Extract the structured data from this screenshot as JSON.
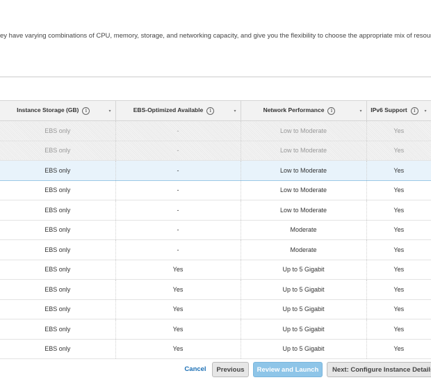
{
  "intro_text": "ey have varying combinations of CPU, memory, storage, and networking capacity, and give you the flexibility to choose the appropriate mix of resources",
  "columns": [
    {
      "label": "Instance Storage (GB)"
    },
    {
      "label": "EBS-Optimized Available"
    },
    {
      "label": "Network Performance"
    },
    {
      "label": "IPv6 Support"
    }
  ],
  "info_glyph": "i",
  "sort_glyph": "▾",
  "rows": [
    {
      "storage": "EBS only",
      "ebs": "-",
      "network": "Low to Moderate",
      "ipv6": "Yes",
      "state": "disabled"
    },
    {
      "storage": "EBS only",
      "ebs": "-",
      "network": "Low to Moderate",
      "ipv6": "Yes",
      "state": "disabled"
    },
    {
      "storage": "EBS only",
      "ebs": "-",
      "network": "Low to Moderate",
      "ipv6": "Yes",
      "state": "selected"
    },
    {
      "storage": "EBS only",
      "ebs": "-",
      "network": "Low to Moderate",
      "ipv6": "Yes",
      "state": "normal"
    },
    {
      "storage": "EBS only",
      "ebs": "-",
      "network": "Low to Moderate",
      "ipv6": "Yes",
      "state": "normal"
    },
    {
      "storage": "EBS only",
      "ebs": "-",
      "network": "Moderate",
      "ipv6": "Yes",
      "state": "normal"
    },
    {
      "storage": "EBS only",
      "ebs": "-",
      "network": "Moderate",
      "ipv6": "Yes",
      "state": "normal"
    },
    {
      "storage": "EBS only",
      "ebs": "Yes",
      "network": "Up to 5 Gigabit",
      "ipv6": "Yes",
      "state": "normal"
    },
    {
      "storage": "EBS only",
      "ebs": "Yes",
      "network": "Up to 5 Gigabit",
      "ipv6": "Yes",
      "state": "normal"
    },
    {
      "storage": "EBS only",
      "ebs": "Yes",
      "network": "Up to 5 Gigabit",
      "ipv6": "Yes",
      "state": "normal"
    },
    {
      "storage": "EBS only",
      "ebs": "Yes",
      "network": "Up to 5 Gigabit",
      "ipv6": "Yes",
      "state": "normal"
    },
    {
      "storage": "EBS only",
      "ebs": "Yes",
      "network": "Up to 5 Gigabit",
      "ipv6": "Yes",
      "state": "normal"
    }
  ],
  "footer": {
    "cancel": "Cancel",
    "previous": "Previous",
    "review": "Review and Launch",
    "next": "Next: Configure Instance Details"
  },
  "colors": {
    "accent": "#1b6fb5",
    "review_button": "#8ec5e8",
    "selected_row": "#e8f3fb"
  }
}
